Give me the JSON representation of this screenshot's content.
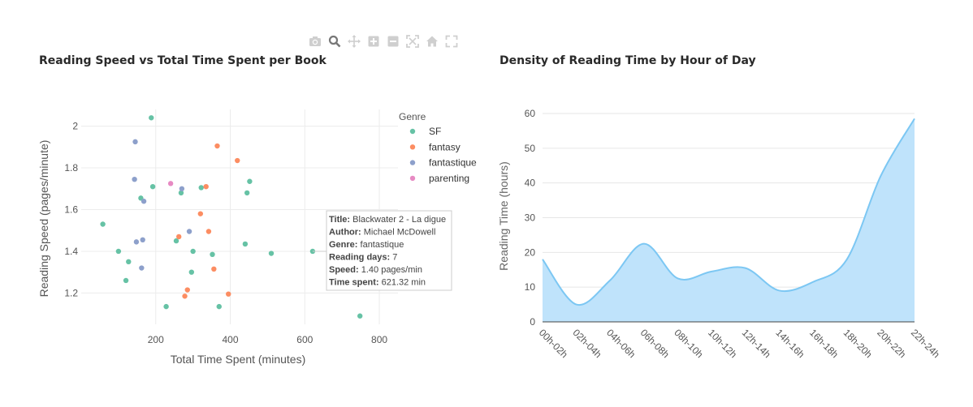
{
  "modebar": {
    "icons": [
      "camera-icon",
      "zoom-icon",
      "pan-icon",
      "zoom-in-icon",
      "zoom-out-icon",
      "autoscale-icon",
      "home-icon",
      "fullscreen-icon"
    ]
  },
  "chart_data": [
    {
      "type": "scatter",
      "title": "Reading Speed vs Total Time Spent per Book",
      "xlabel": "Total Time Spent (minutes)",
      "ylabel": "Reading Speed (pages/minute)",
      "xticks": [
        200,
        400,
        600,
        800
      ],
      "yticks": [
        1.2,
        1.4,
        1.6,
        1.8,
        2
      ],
      "xlim": [
        0,
        850
      ],
      "ylim": [
        1.05,
        2.08
      ],
      "grid": true,
      "legend": {
        "title": "Genre",
        "position": "top-right"
      },
      "series": [
        {
          "name": "SF",
          "color": "#66c2a5",
          "points": [
            [
              188,
              2.04
            ],
            [
              58,
              1.53
            ],
            [
              100,
              1.4
            ],
            [
              127,
              1.35
            ],
            [
              120,
              1.26
            ],
            [
              160,
              1.655
            ],
            [
              192,
              1.71
            ],
            [
              228,
              1.135
            ],
            [
              255,
              1.45
            ],
            [
              268,
              1.68
            ],
            [
              296,
              1.3
            ],
            [
              300,
              1.4
            ],
            [
              322,
              1.705
            ],
            [
              352,
              1.385
            ],
            [
              370,
              1.135
            ],
            [
              440,
              1.435
            ],
            [
              445,
              1.68
            ],
            [
              452,
              1.735
            ],
            [
              510,
              1.39
            ],
            [
              621,
              1.4
            ],
            [
              748,
              1.09
            ]
          ]
        },
        {
          "name": "fantasy",
          "color": "#fc8d62",
          "points": [
            [
              262,
              1.47
            ],
            [
              278,
              1.185
            ],
            [
              285,
              1.215
            ],
            [
              320,
              1.58
            ],
            [
              335,
              1.71
            ],
            [
              342,
              1.495
            ],
            [
              356,
              1.315
            ],
            [
              365,
              1.905
            ],
            [
              395,
              1.195
            ],
            [
              419,
              1.835
            ]
          ]
        },
        {
          "name": "fantastique",
          "color": "#8da0cb",
          "points": [
            [
              145,
              1.925
            ],
            [
              143,
              1.745
            ],
            [
              148,
              1.445
            ],
            [
              162,
              1.32
            ],
            [
              165,
              1.455
            ],
            [
              168,
              1.64
            ],
            [
              270,
              1.7
            ],
            [
              290,
              1.495
            ]
          ]
        },
        {
          "name": "parenting",
          "color": "#e78ac3",
          "points": [
            [
              240,
              1.725
            ]
          ]
        }
      ],
      "tooltip": {
        "rows": [
          {
            "label": "Title:",
            "value": "Blackwater 2 - La digue"
          },
          {
            "label": "Author:",
            "value": "Michael McDowell"
          },
          {
            "label": "Genre:",
            "value": "fantastique"
          },
          {
            "label": "Reading days:",
            "value": "7"
          },
          {
            "label": "Speed:",
            "value": "1.40 pages/min"
          },
          {
            "label": "Time spent:",
            "value": "621.32 min"
          }
        ]
      }
    },
    {
      "type": "area",
      "title": "Density of Reading Time by Hour of Day",
      "xlabel": "",
      "ylabel": "Reading Time (hours)",
      "categories": [
        "00h-02h",
        "02h-04h",
        "04h-06h",
        "06h-08h",
        "08h-10h",
        "10h-12h",
        "12h-14h",
        "14h-16h",
        "16h-18h",
        "18h-20h",
        "20h-22h",
        "22h-24h"
      ],
      "yticks": [
        0,
        10,
        20,
        30,
        40,
        50,
        60
      ],
      "ylim": [
        0,
        60
      ],
      "grid": true,
      "fill_color": "#bfe3fb",
      "line_color": "#7cc7f3",
      "values": [
        18,
        5,
        12,
        22.5,
        12.5,
        14.5,
        15.5,
        9,
        11.5,
        18,
        42,
        58.5
      ]
    }
  ]
}
